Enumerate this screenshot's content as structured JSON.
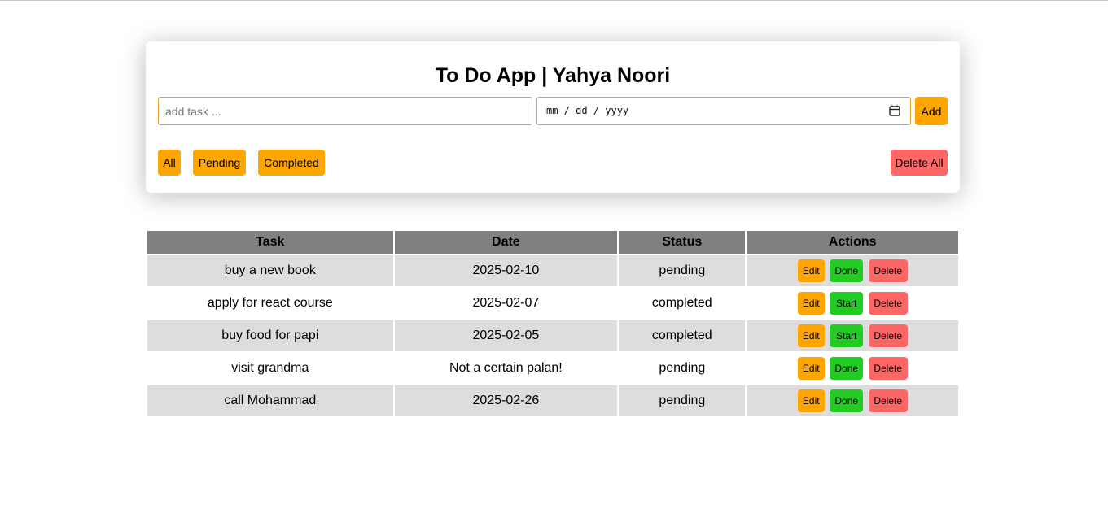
{
  "app": {
    "title": "To Do App | Yahya Noori"
  },
  "form": {
    "task_placeholder": "add task ...",
    "task_value": "",
    "date_placeholder": "mm / dd / yyyy",
    "add_label": "Add"
  },
  "filters": {
    "all_label": "All",
    "pending_label": "Pending",
    "completed_label": "Completed",
    "delete_all_label": "Delete All"
  },
  "table": {
    "headers": [
      "Task",
      "Date",
      "Status",
      "Actions"
    ],
    "rows": [
      {
        "task": "buy a new book",
        "date": "2025-02-10",
        "status": "pending",
        "edit": "Edit",
        "toggle": "Done",
        "delete": "Delete"
      },
      {
        "task": "apply for react course",
        "date": "2025-02-07",
        "status": "completed",
        "edit": "Edit",
        "toggle": "Start",
        "delete": "Delete"
      },
      {
        "task": "buy food for papi",
        "date": "2025-02-05",
        "status": "completed",
        "edit": "Edit",
        "toggle": "Start",
        "delete": "Delete"
      },
      {
        "task": "visit grandma",
        "date": "Not a certain palan!",
        "status": "pending",
        "edit": "Edit",
        "toggle": "Done",
        "delete": "Delete"
      },
      {
        "task": "call Mohammad",
        "date": "2025-02-26",
        "status": "pending",
        "edit": "Edit",
        "toggle": "Done",
        "delete": "Delete"
      }
    ]
  },
  "colors": {
    "accent_orange": "#ffa500",
    "danger_red": "#ff6666",
    "success_green": "#22cc22",
    "header_gray": "#808080",
    "row_alt_gray": "#dddddd"
  },
  "icons": {
    "date_picker": "calendar-icon"
  }
}
